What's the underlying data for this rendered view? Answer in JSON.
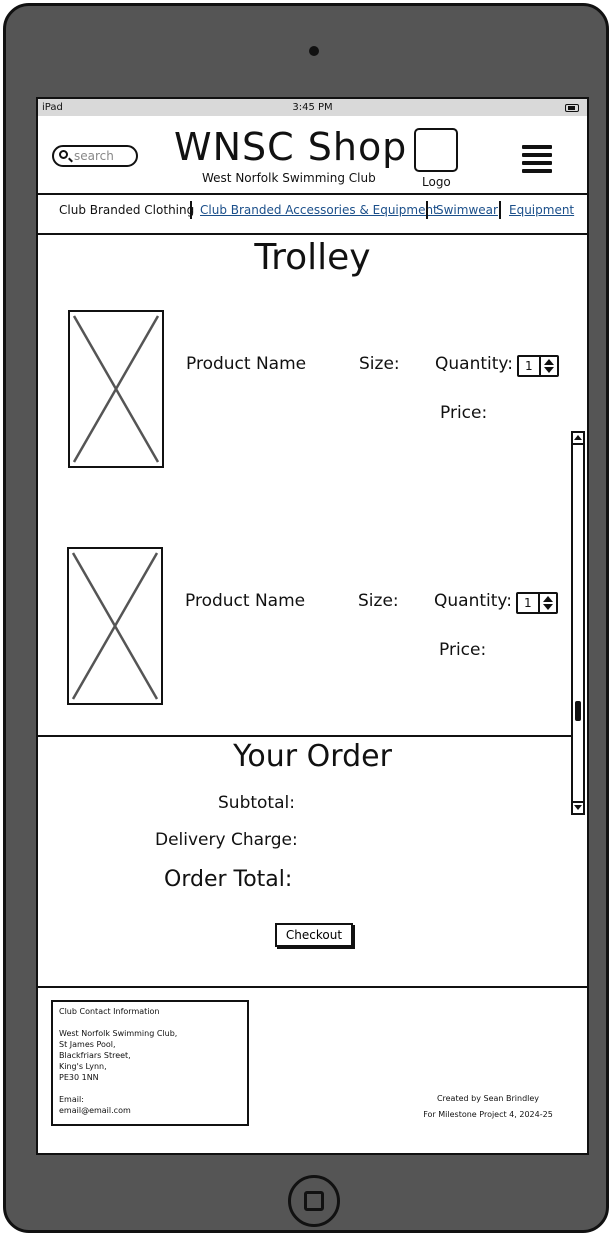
{
  "status_bar": {
    "carrier": "iPad",
    "time": "3:45 PM"
  },
  "header": {
    "search_placeholder": "search",
    "title": "WNSC Shop",
    "subtitle": "West Norfolk Swimming Club",
    "logo_label": "Logo"
  },
  "nav": {
    "items": [
      {
        "label": "Club Branded Clothing"
      },
      {
        "label": "Club Branded Accessories & Equipment"
      },
      {
        "label": "Swimwear"
      },
      {
        "label": "Equipment"
      }
    ]
  },
  "trolley": {
    "title": "Trolley",
    "items": [
      {
        "product_name": "Product Name",
        "size_label": "Size:",
        "quantity_label": "Quantity:",
        "quantity_value": "1",
        "price_label": "Price:"
      },
      {
        "product_name": "Product Name",
        "size_label": "Size:",
        "quantity_label": "Quantity:",
        "quantity_value": "1",
        "price_label": "Price:"
      }
    ]
  },
  "order": {
    "title": "Your Order",
    "subtotal_label": "Subtotal:",
    "delivery_label": "Delivery Charge:",
    "total_label": "Order Total:",
    "checkout_label": "Checkout"
  },
  "footer": {
    "contact_title": "Club Contact Information",
    "address": [
      "West Norfolk Swimming Club,",
      "St James Pool,",
      "Blackfriars Street,",
      "King's Lynn,",
      "PE30 1NN"
    ],
    "email_label": "Email:",
    "email_value": "email@email.com",
    "credit_line1": "Created by Sean Brindley",
    "credit_line2": "For Milestone Project 4, 2024-25"
  }
}
